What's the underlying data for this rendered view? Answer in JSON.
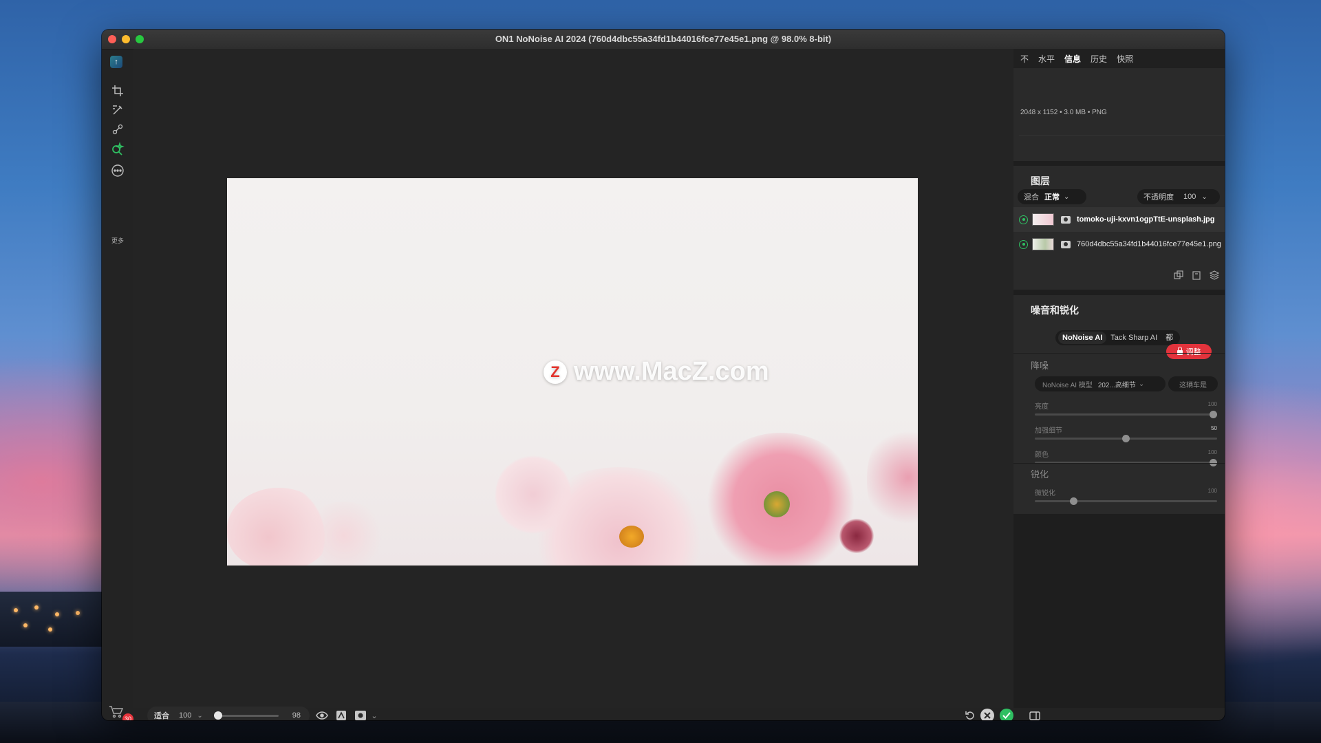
{
  "window": {
    "title": "ON1 NoNoise AI 2024 (760d4dbc55a34fd1b44016fce77e45e1.png @ 98.0% 8-bit)"
  },
  "toolbar": {
    "more_label": "更多",
    "cart_badge": "30"
  },
  "canvas": {
    "watermark_text": "www.MacZ.com",
    "watermark_logo": "Z"
  },
  "bottombar": {
    "fit_label": "适合",
    "zoom_value": "100",
    "zoom_slider_value": "98",
    "zoom_slider_fraction": 0.0
  },
  "panel": {
    "tabs": [
      {
        "label": "不"
      },
      {
        "label": "水平"
      },
      {
        "label": "信息",
        "active": true
      },
      {
        "label": "历史"
      },
      {
        "label": "快照"
      }
    ],
    "info": {
      "text": "2048 x 1152 • 3.0 MB • PNG"
    },
    "layers": {
      "title": "图层",
      "blend_label": "混合",
      "blend_value": "正常",
      "opacity_label": "不透明度",
      "opacity_value": "100",
      "items": [
        {
          "name": "tomoko-uji-kxvn1ogpTtE-unsplash.jpg",
          "selected": true
        },
        {
          "name": "760d4dbc55a34fd1b44016fce77e45e1.png",
          "selected": false
        }
      ]
    },
    "noise": {
      "title": "噪音和锐化",
      "modes": [
        "NoNoise AI",
        "Tack Sharp AI",
        "都"
      ],
      "active_mode": "NoNoise AI",
      "adjust_label": "调整",
      "denoise_title": "降噪",
      "model_label": "NoNoise AI 模型",
      "model_value": "202...高细节",
      "reset_label": "这辆车是",
      "controls": [
        {
          "label": "亮度",
          "value": "100",
          "fraction": 1.0
        },
        {
          "label": "加强细节",
          "value": "50",
          "fraction": 0.5
        },
        {
          "label": "颜色",
          "value": "100",
          "fraction": 1.0
        }
      ],
      "sharpen_title": "锐化",
      "sharpen_controls": [
        {
          "label": "微锐化",
          "value": "100",
          "fraction": 0.2
        }
      ]
    }
  },
  "colors": {
    "accent_green": "#2fbf62",
    "accent_red": "#e2333c"
  }
}
